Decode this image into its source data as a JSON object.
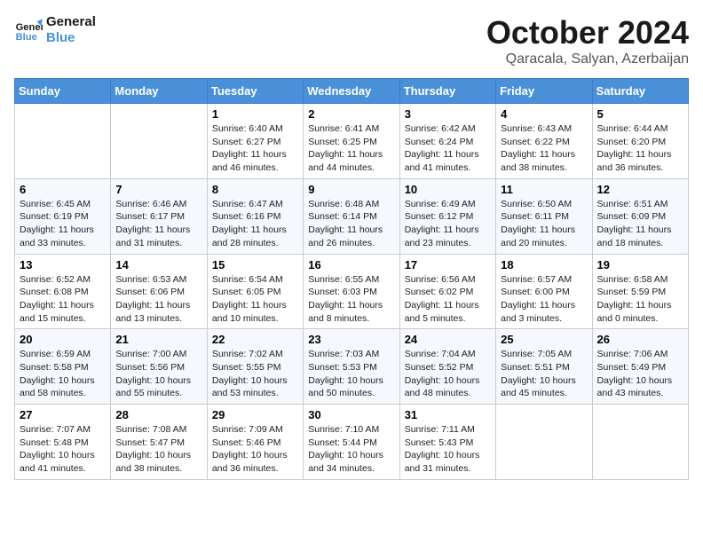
{
  "header": {
    "logo_general": "General",
    "logo_blue": "Blue",
    "month_title": "October 2024",
    "subtitle": "Qaracala, Salyan, Azerbaijan"
  },
  "weekdays": [
    "Sunday",
    "Monday",
    "Tuesday",
    "Wednesday",
    "Thursday",
    "Friday",
    "Saturday"
  ],
  "weeks": [
    [
      {
        "day": "",
        "sunrise": "",
        "sunset": "",
        "daylight": ""
      },
      {
        "day": "",
        "sunrise": "",
        "sunset": "",
        "daylight": ""
      },
      {
        "day": "1",
        "sunrise": "Sunrise: 6:40 AM",
        "sunset": "Sunset: 6:27 PM",
        "daylight": "Daylight: 11 hours and 46 minutes."
      },
      {
        "day": "2",
        "sunrise": "Sunrise: 6:41 AM",
        "sunset": "Sunset: 6:25 PM",
        "daylight": "Daylight: 11 hours and 44 minutes."
      },
      {
        "day": "3",
        "sunrise": "Sunrise: 6:42 AM",
        "sunset": "Sunset: 6:24 PM",
        "daylight": "Daylight: 11 hours and 41 minutes."
      },
      {
        "day": "4",
        "sunrise": "Sunrise: 6:43 AM",
        "sunset": "Sunset: 6:22 PM",
        "daylight": "Daylight: 11 hours and 38 minutes."
      },
      {
        "day": "5",
        "sunrise": "Sunrise: 6:44 AM",
        "sunset": "Sunset: 6:20 PM",
        "daylight": "Daylight: 11 hours and 36 minutes."
      }
    ],
    [
      {
        "day": "6",
        "sunrise": "Sunrise: 6:45 AM",
        "sunset": "Sunset: 6:19 PM",
        "daylight": "Daylight: 11 hours and 33 minutes."
      },
      {
        "day": "7",
        "sunrise": "Sunrise: 6:46 AM",
        "sunset": "Sunset: 6:17 PM",
        "daylight": "Daylight: 11 hours and 31 minutes."
      },
      {
        "day": "8",
        "sunrise": "Sunrise: 6:47 AM",
        "sunset": "Sunset: 6:16 PM",
        "daylight": "Daylight: 11 hours and 28 minutes."
      },
      {
        "day": "9",
        "sunrise": "Sunrise: 6:48 AM",
        "sunset": "Sunset: 6:14 PM",
        "daylight": "Daylight: 11 hours and 26 minutes."
      },
      {
        "day": "10",
        "sunrise": "Sunrise: 6:49 AM",
        "sunset": "Sunset: 6:12 PM",
        "daylight": "Daylight: 11 hours and 23 minutes."
      },
      {
        "day": "11",
        "sunrise": "Sunrise: 6:50 AM",
        "sunset": "Sunset: 6:11 PM",
        "daylight": "Daylight: 11 hours and 20 minutes."
      },
      {
        "day": "12",
        "sunrise": "Sunrise: 6:51 AM",
        "sunset": "Sunset: 6:09 PM",
        "daylight": "Daylight: 11 hours and 18 minutes."
      }
    ],
    [
      {
        "day": "13",
        "sunrise": "Sunrise: 6:52 AM",
        "sunset": "Sunset: 6:08 PM",
        "daylight": "Daylight: 11 hours and 15 minutes."
      },
      {
        "day": "14",
        "sunrise": "Sunrise: 6:53 AM",
        "sunset": "Sunset: 6:06 PM",
        "daylight": "Daylight: 11 hours and 13 minutes."
      },
      {
        "day": "15",
        "sunrise": "Sunrise: 6:54 AM",
        "sunset": "Sunset: 6:05 PM",
        "daylight": "Daylight: 11 hours and 10 minutes."
      },
      {
        "day": "16",
        "sunrise": "Sunrise: 6:55 AM",
        "sunset": "Sunset: 6:03 PM",
        "daylight": "Daylight: 11 hours and 8 minutes."
      },
      {
        "day": "17",
        "sunrise": "Sunrise: 6:56 AM",
        "sunset": "Sunset: 6:02 PM",
        "daylight": "Daylight: 11 hours and 5 minutes."
      },
      {
        "day": "18",
        "sunrise": "Sunrise: 6:57 AM",
        "sunset": "Sunset: 6:00 PM",
        "daylight": "Daylight: 11 hours and 3 minutes."
      },
      {
        "day": "19",
        "sunrise": "Sunrise: 6:58 AM",
        "sunset": "Sunset: 5:59 PM",
        "daylight": "Daylight: 11 hours and 0 minutes."
      }
    ],
    [
      {
        "day": "20",
        "sunrise": "Sunrise: 6:59 AM",
        "sunset": "Sunset: 5:58 PM",
        "daylight": "Daylight: 10 hours and 58 minutes."
      },
      {
        "day": "21",
        "sunrise": "Sunrise: 7:00 AM",
        "sunset": "Sunset: 5:56 PM",
        "daylight": "Daylight: 10 hours and 55 minutes."
      },
      {
        "day": "22",
        "sunrise": "Sunrise: 7:02 AM",
        "sunset": "Sunset: 5:55 PM",
        "daylight": "Daylight: 10 hours and 53 minutes."
      },
      {
        "day": "23",
        "sunrise": "Sunrise: 7:03 AM",
        "sunset": "Sunset: 5:53 PM",
        "daylight": "Daylight: 10 hours and 50 minutes."
      },
      {
        "day": "24",
        "sunrise": "Sunrise: 7:04 AM",
        "sunset": "Sunset: 5:52 PM",
        "daylight": "Daylight: 10 hours and 48 minutes."
      },
      {
        "day": "25",
        "sunrise": "Sunrise: 7:05 AM",
        "sunset": "Sunset: 5:51 PM",
        "daylight": "Daylight: 10 hours and 45 minutes."
      },
      {
        "day": "26",
        "sunrise": "Sunrise: 7:06 AM",
        "sunset": "Sunset: 5:49 PM",
        "daylight": "Daylight: 10 hours and 43 minutes."
      }
    ],
    [
      {
        "day": "27",
        "sunrise": "Sunrise: 7:07 AM",
        "sunset": "Sunset: 5:48 PM",
        "daylight": "Daylight: 10 hours and 41 minutes."
      },
      {
        "day": "28",
        "sunrise": "Sunrise: 7:08 AM",
        "sunset": "Sunset: 5:47 PM",
        "daylight": "Daylight: 10 hours and 38 minutes."
      },
      {
        "day": "29",
        "sunrise": "Sunrise: 7:09 AM",
        "sunset": "Sunset: 5:46 PM",
        "daylight": "Daylight: 10 hours and 36 minutes."
      },
      {
        "day": "30",
        "sunrise": "Sunrise: 7:10 AM",
        "sunset": "Sunset: 5:44 PM",
        "daylight": "Daylight: 10 hours and 34 minutes."
      },
      {
        "day": "31",
        "sunrise": "Sunrise: 7:11 AM",
        "sunset": "Sunset: 5:43 PM",
        "daylight": "Daylight: 10 hours and 31 minutes."
      },
      {
        "day": "",
        "sunrise": "",
        "sunset": "",
        "daylight": ""
      },
      {
        "day": "",
        "sunrise": "",
        "sunset": "",
        "daylight": ""
      }
    ]
  ]
}
